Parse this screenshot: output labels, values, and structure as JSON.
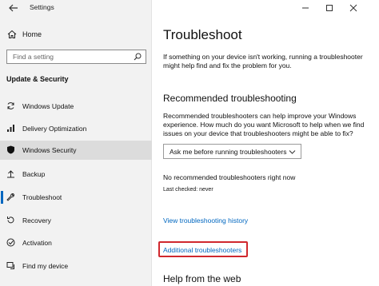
{
  "window": {
    "app_title": "Settings"
  },
  "sidebar": {
    "home_label": "Home",
    "search_placeholder": "Find a setting",
    "section_title": "Update & Security",
    "items": [
      {
        "label": "Windows Update",
        "icon": "sync-icon"
      },
      {
        "label": "Delivery Optimization",
        "icon": "delivery-optimization-icon"
      },
      {
        "label": "Windows Security",
        "icon": "shield-icon",
        "selected": true
      },
      {
        "label": "Backup",
        "icon": "backup-icon"
      },
      {
        "label": "Troubleshoot",
        "icon": "wrench-icon"
      },
      {
        "label": "Recovery",
        "icon": "recovery-icon"
      },
      {
        "label": "Activation",
        "icon": "activation-icon"
      },
      {
        "label": "Find my device",
        "icon": "find-device-icon"
      }
    ]
  },
  "main": {
    "title": "Troubleshoot",
    "intro": "If something on your device isn't working, running a troubleshooter might help find and fix the problem for you.",
    "recommended_heading": "Recommended troubleshooting",
    "recommended_body": "Recommended troubleshooters can help improve your Windows experience. How much do you want Microsoft to help when we find issues on your device that troubleshooters might be able to fix?",
    "dropdown_value": "Ask me before running troubleshooters",
    "no_recommended": "No recommended troubleshooters right now",
    "last_checked": "Last checked: never",
    "history_link": "View troubleshooting history",
    "additional_link": "Additional troubleshooters",
    "help_heading": "Help from the web"
  },
  "colors": {
    "accent": "#0067c0",
    "highlight_box": "#d0282e",
    "sidebar_bg": "#f2f2f2",
    "selected_bg": "#dcdcdc"
  }
}
